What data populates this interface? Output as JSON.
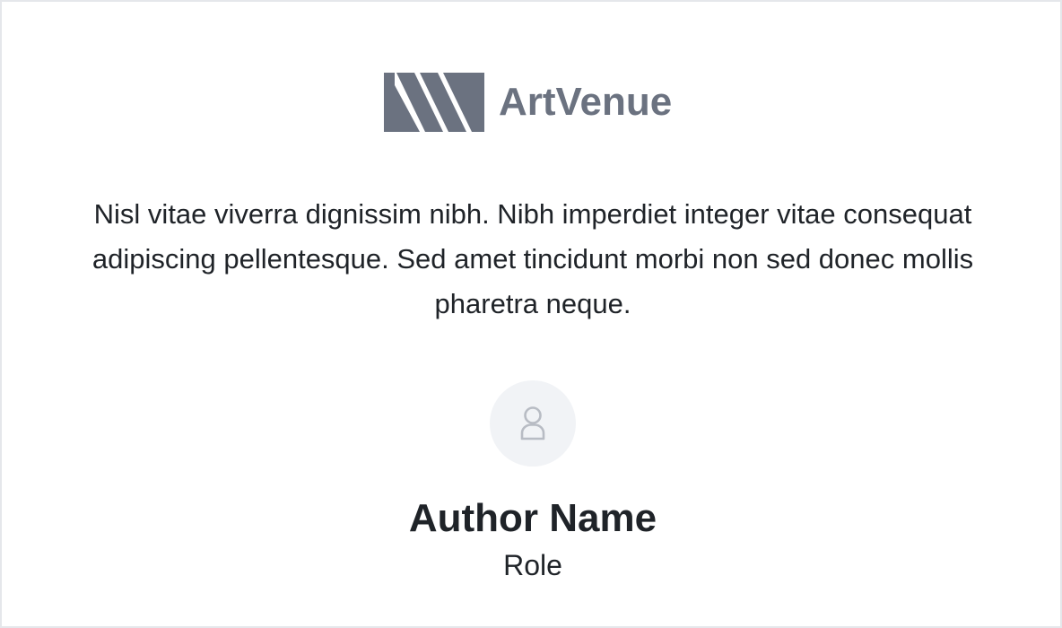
{
  "brand": {
    "name": "ArtVenue",
    "logo_icon": "artvenue-logo-icon",
    "color": "#6b7280"
  },
  "testimonial": {
    "quote": "Nisl vitae viverra dignissim nibh. Nibh imperdiet integer vitae consequat adipiscing pellentesque. Sed amet tincidunt morbi non sed donec mollis pharetra neque."
  },
  "author": {
    "avatar_icon": "user-icon",
    "name": "Author Name",
    "role": "Role"
  },
  "colors": {
    "text": "#1f2328",
    "avatar_bg": "#f1f3f6",
    "border": "#e5e7eb"
  }
}
